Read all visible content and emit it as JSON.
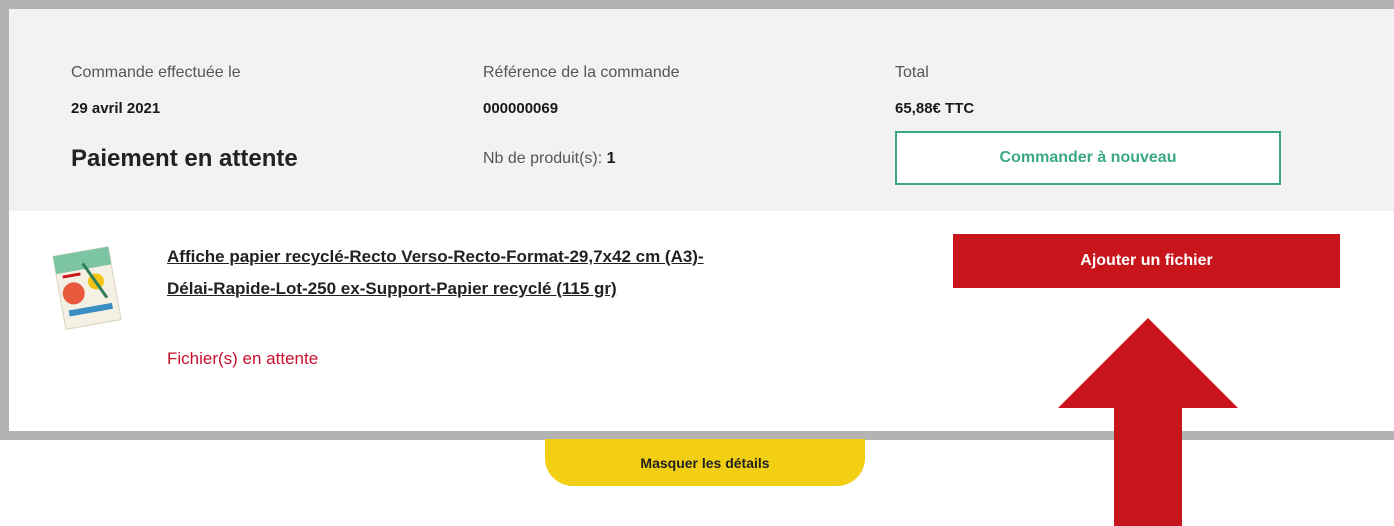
{
  "order": {
    "date_label": "Commande effectuée le",
    "date_value": "29 avril 2021",
    "reference_label": "Référence de la commande",
    "reference_value": "000000069",
    "total_label": "Total",
    "total_value": "65,88€ TTC",
    "status": "Paiement en attente",
    "product_count_label": "Nb de produit(s):",
    "product_count_value": "1",
    "reorder_label": "Commander à nouveau"
  },
  "product": {
    "thumbnail_icon": "poster-thumbnail-icon",
    "title": "Affiche papier recyclé-Recto Verso-Recto-Format-29,7x42 cm (A3)-Délai-Rapide-Lot-250 ex-Support-Papier recyclé (115 gr)",
    "file_status": "Fichier(s) en attente",
    "add_file_label": "Ajouter un fichier"
  },
  "details": {
    "toggle_label": "Masquer les détails"
  },
  "annotation": {
    "arrow_icon": "up-arrow-icon",
    "arrow_color": "#c8151b"
  },
  "colors": {
    "accent_green": "#3aa786",
    "accent_red": "#c8151b",
    "accent_yellow": "#f2cf12",
    "status_red": "#c8102e"
  }
}
